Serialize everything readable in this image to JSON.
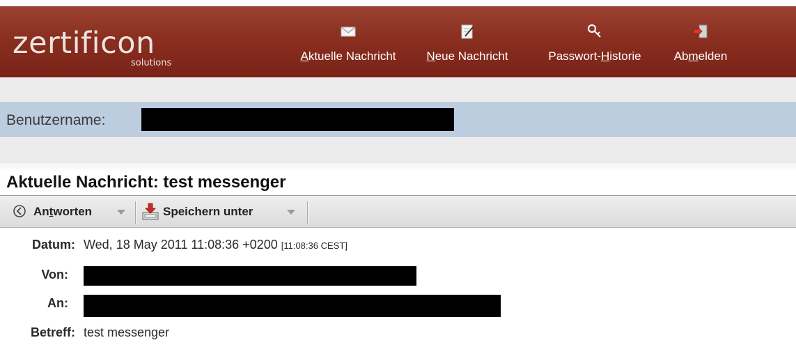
{
  "header": {
    "logo_main": "zertificon",
    "logo_sub": "solutions",
    "nav": [
      {
        "label_pre": "",
        "label_u": "A",
        "label_post": "ktuelle Nachricht",
        "icon": "envelope-icon"
      },
      {
        "label_pre": "",
        "label_u": "N",
        "label_post": "eue Nachricht",
        "icon": "notepad-pencil-icon"
      },
      {
        "label_pre": "Passwort-",
        "label_u": "H",
        "label_post": "istorie",
        "icon": "key-icon"
      },
      {
        "label_pre": "Ab",
        "label_u": "m",
        "label_post": "elden",
        "icon": "logout-door-icon"
      }
    ]
  },
  "user": {
    "label": "Benutzername:"
  },
  "message": {
    "title": "Aktuelle Nachricht: test messenger",
    "toolbar": {
      "reply_pre": "An",
      "reply_u": "t",
      "reply_post": "worten",
      "save_label": "Speichern unter"
    },
    "fields": {
      "date_label": "Datum:",
      "date_value": "Wed, 18 May 2011 11:08:36 +0200",
      "date_local": "[11:08:36 CEST]",
      "from_label": "Von:",
      "to_label": "An:",
      "subject_label": "Betreff:",
      "subject_value": "test messenger"
    }
  },
  "colors": {
    "header_bg": "#8a2f20",
    "user_row_bg": "#bdcde0",
    "redaction": "#000000"
  }
}
